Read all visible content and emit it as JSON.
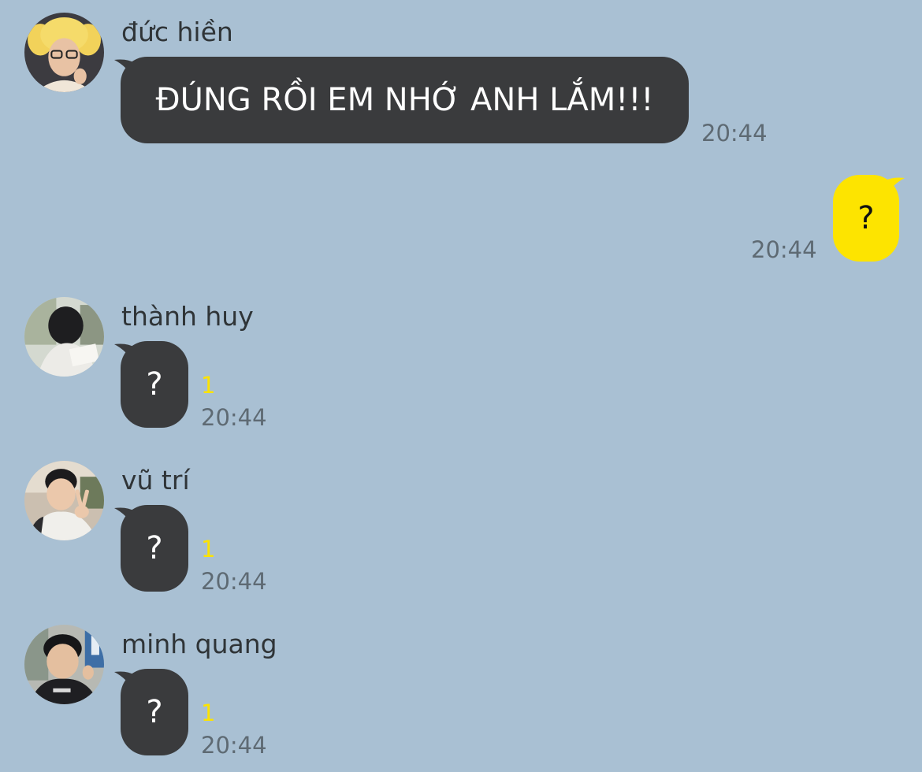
{
  "colors": {
    "background": "#a9c0d3",
    "incoming_bubble": "#3a3b3d",
    "outgoing_bubble": "#fde400",
    "unread": "#fce300",
    "timestamp": "#5e6a73"
  },
  "messages": [
    {
      "sender": "đức hiền",
      "avatar_icon": "profile-photo-icon",
      "text": "ĐÚNG RỒI EM NHỚ ANH LẮM!!!",
      "time": "20:44"
    },
    {
      "outgoing": true,
      "text": "?",
      "time": "20:44"
    },
    {
      "sender": "thành huy",
      "avatar_icon": "profile-photo-icon",
      "text": "?",
      "unread": "1",
      "time": "20:44"
    },
    {
      "sender": "vũ trí",
      "avatar_icon": "profile-photo-icon",
      "text": "?",
      "unread": "1",
      "time": "20:44"
    },
    {
      "sender": "minh quang",
      "avatar_icon": "profile-photo-icon",
      "text": "?",
      "unread": "1",
      "time": "20:44"
    }
  ]
}
